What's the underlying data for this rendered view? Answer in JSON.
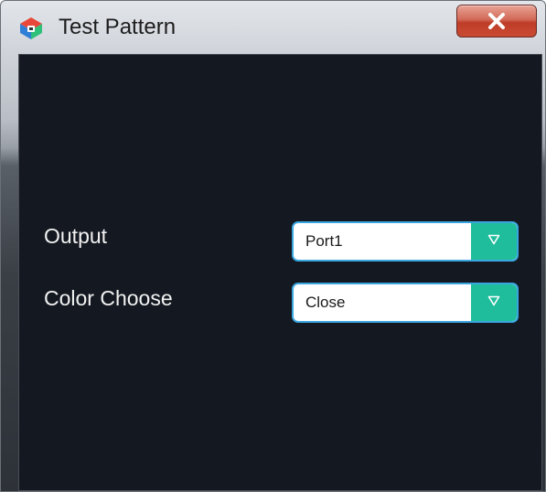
{
  "window": {
    "title": "Test Pattern",
    "app_icon": "app-logo-icon",
    "close_icon": "close-icon"
  },
  "form": {
    "output": {
      "label": "Output",
      "value": "Port1",
      "arrow_icon": "triangle-down-icon"
    },
    "color_choose": {
      "label": "Color Choose",
      "value": "Close",
      "arrow_icon": "triangle-down-icon"
    }
  },
  "colors": {
    "panel_background": "#141821",
    "select_accent": "#1fbd9b",
    "select_border": "#3aa6e0",
    "close_button": "#c94a32"
  }
}
